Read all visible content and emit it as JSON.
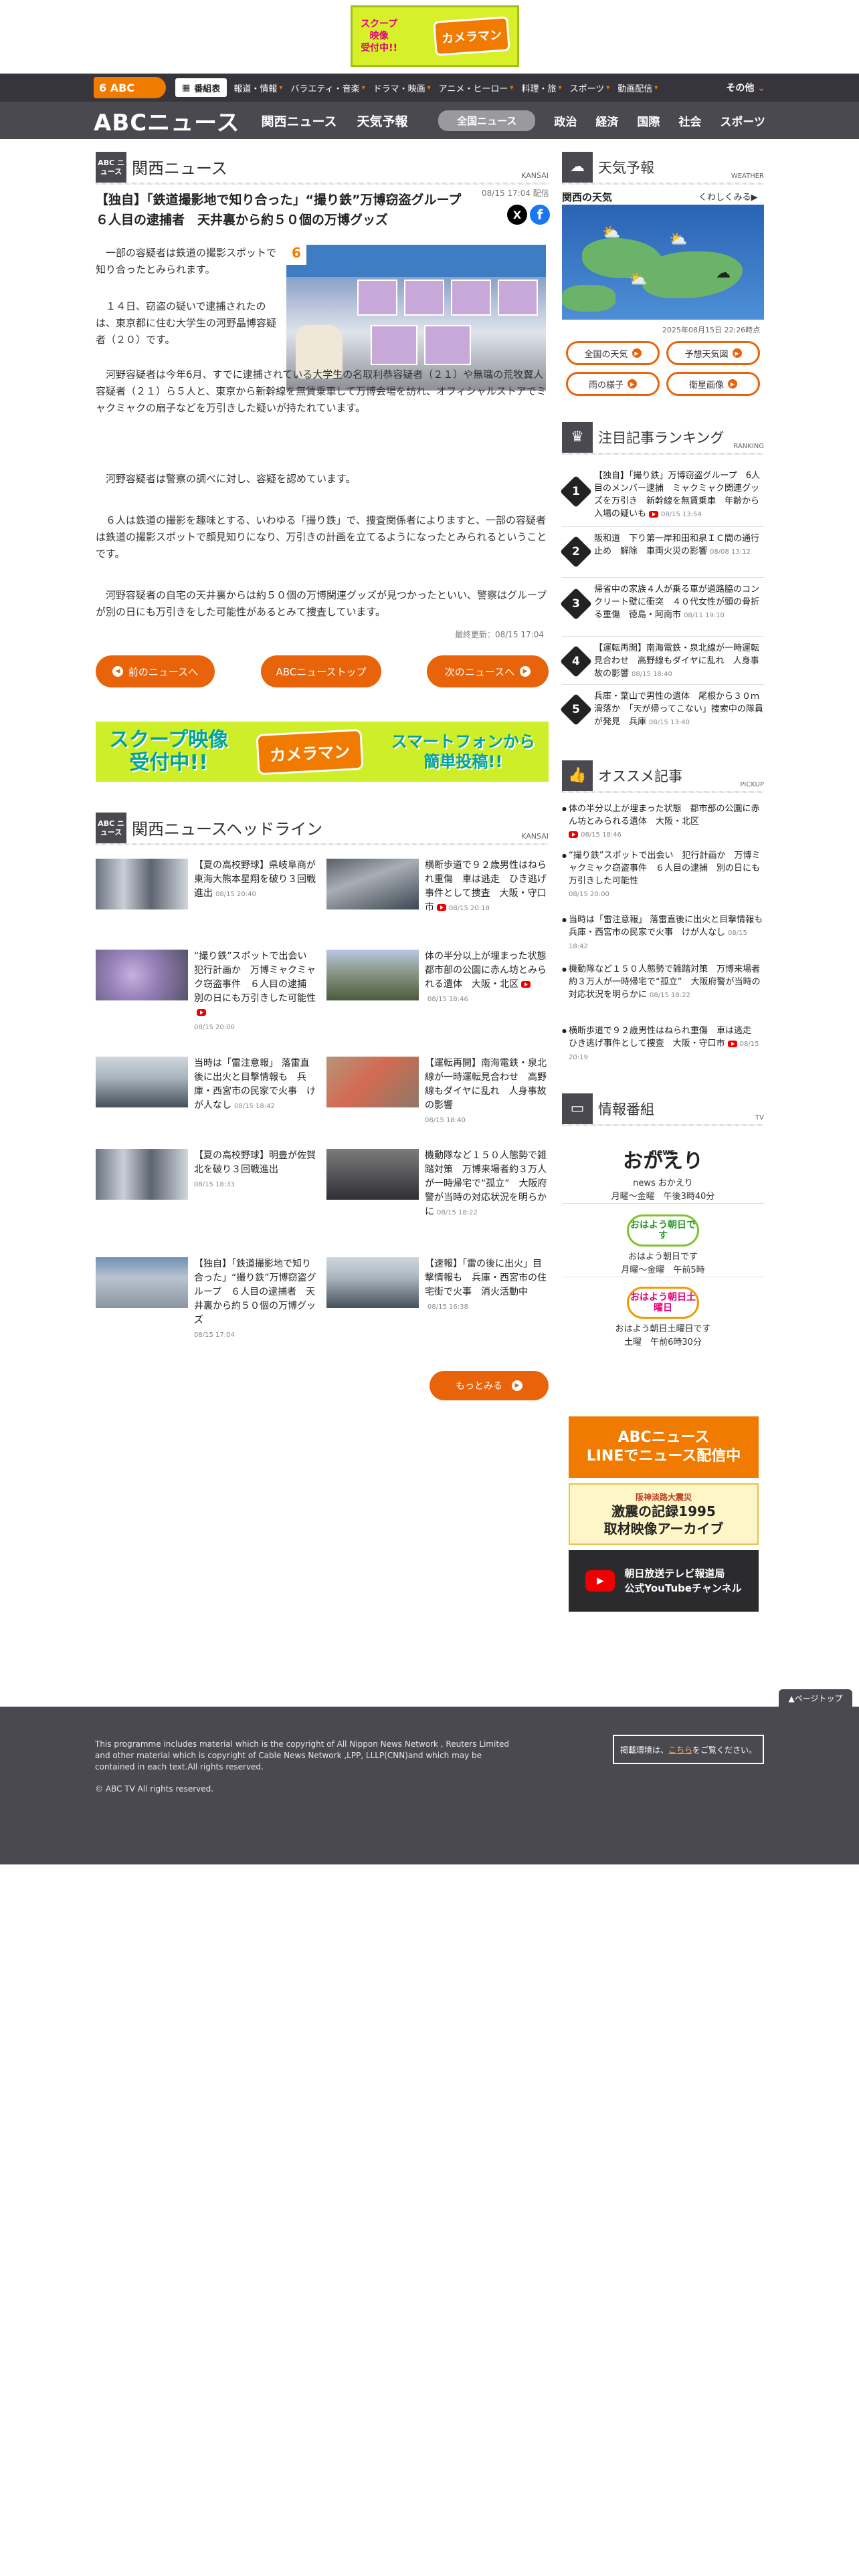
{
  "top_banner": {
    "line1": "スクープ",
    "line2": "映像",
    "line3": "受付中!!",
    "brand": "カメラマン"
  },
  "nav1": {
    "logo": "6 ABC",
    "bangumi": "番組表",
    "items": [
      "報道・情報",
      "バラエティ・音楽",
      "ドラマ・映画",
      "アニメ・ヒーロー",
      "料理・旅",
      "スポーツ",
      "動画配信"
    ],
    "other": "その他"
  },
  "nav2": {
    "logo": "ABCニュース",
    "items": [
      "関西ニュース",
      "天気予報"
    ],
    "pill": "全国ニュース",
    "right": [
      "政治",
      "経済",
      "国際",
      "社会",
      "スポーツ"
    ]
  },
  "section": {
    "icon": "ABC ニュース",
    "title": "関西ニュース",
    "tag": "KANSAI"
  },
  "article": {
    "title": "【独自】「鉄道撮影地で知り合った」“撮り鉄”万博窃盗グループ　６人目の逮捕者　天井裏から約５０個の万博グッズ",
    "meta": "08/15 17:04 配信",
    "share_x": "X",
    "share_fb": "f",
    "photo_label": "6",
    "p1": "一部の容疑者は鉄道の撮影スポットで知り合ったとみられます。",
    "p2": "１４日、窃盗の疑いで逮捕されたのは、東京都に住む大学生の河野晶博容疑者（２０）です。",
    "p3": "河野容疑者は今年6月、すでに逮捕されている大学生の名取利恭容疑者（２１）や無職の荒牧翼人容疑者（２１）ら５人と、東京から新幹線を無賃乗車して万博会場を訪れ、オフィシャルストアでミャクミャクの扇子などを万引きした疑いが持たれています。",
    "p4": "河野容疑者は警察の調べに対し、容疑を認めています。",
    "p5": "６人は鉄道の撮影を趣味とする、いわゆる「撮り鉄」で、捜査関係者によりますと、一部の容疑者は鉄道の撮影スポットで顔見知りになり、万引きの計画を立てるようになったとみられるということです。",
    "p6": "河野容疑者の自宅の天井裏からは約５０個の万博関連グッズが見つかったといい、警察はグループが別の日にも万引きをした可能性があるとみて捜査しています。",
    "updated": "最終更新：08/15 17:04"
  },
  "nav_buttons": {
    "prev": "前のニュースへ",
    "top": "ABCニューストップ",
    "next": "次のニュースへ"
  },
  "mid_banner": {
    "left": "スクープ映像\n受付中!!",
    "brand": "カメラマン",
    "right": "スマートフォンから\n簡単投稿!!"
  },
  "headline_section": {
    "icon": "ABC ニュース",
    "title": "関西ニュースヘッドライン",
    "tag": "KANSAI"
  },
  "headlines": [
    {
      "text": "【夏の高校野球】県岐阜商が東海大熊本星翔を破り３回戦進出",
      "date": "08/15 20:40",
      "yt": false
    },
    {
      "text": "横断歩道で９２歳男性はねられ重傷　車は逃走　ひき逃げ事件として捜査　大阪・守口市",
      "date": "08/15 20:18",
      "yt": true
    },
    {
      "text": "“撮り鉄”スポットで出会い　犯行計画か　万博ミャクミャク窃盗事件　６人目の逮捕　別の日にも万引きした可能性",
      "date": "08/15 20:00",
      "yt": true
    },
    {
      "text": "体の半分以上が埋まった状態　都市部の公園に赤ん坊とみられる遺体　大阪・北区",
      "date": "08/15 18:46",
      "yt": true
    },
    {
      "text": "当時は「雷注意報」 落雷直後に出火と目撃情報も　兵庫・西宮市の民家で火事　けが人なし",
      "date": "08/15 18:42",
      "yt": false
    },
    {
      "text": "【運転再開】南海電鉄・泉北線が一時運転見合わせ　高野線もダイヤに乱れ　人身事故の影響",
      "date": "08/15 18:40",
      "yt": false
    },
    {
      "text": "【夏の高校野球】明豊が佐賀北を破り３回戦進出",
      "date": "08/15 18:33",
      "yt": false
    },
    {
      "text": "機動隊など１５０人態勢で雑踏対策　万博来場者約３万人が一時帰宅で“孤立”　大阪府警が当時の対応状況を明らかに",
      "date": "08/15 18:22",
      "yt": false
    },
    {
      "text": "【独自】「鉄道撮影地で知り合った」“撮り鉄”万博窃盗グループ　６人目の逮捕者　天井裏から約５０個の万博グッズ",
      "date": "08/15 17:04",
      "yt": false
    },
    {
      "text": "【速報】「雷の後に出火」目撃情報も　兵庫・西宮市の住宅街で火事　消火活動中",
      "date": "08/15 16:38",
      "yt": false
    }
  ],
  "more_button": "もっとみる",
  "weather": {
    "title": "天気予報",
    "tag": "WEATHER",
    "area": "関西の天気",
    "more": "くわしくみる",
    "date": "2025年08月15日 22:26時点",
    "buttons": [
      "全国の天気",
      "予想天気図",
      "雨の様子",
      "衛星画像"
    ]
  },
  "ranking": {
    "title": "注目記事ランキング",
    "tag": "RANKING",
    "items": [
      {
        "rank": "1",
        "text": "【独自】「撮り鉄」万博窃盗グループ　6人目のメンバー逮捕　ミャクミャク関連グッズを万引き　新幹線を無賃乗車　年齢から入場の疑いも",
        "date": "08/15 13:54",
        "yt": true
      },
      {
        "rank": "2",
        "text": "阪和道　下り第一岸和田和泉ＩＣ間の通行止め　解除　車両火災の影響",
        "date": "08/08 13:12",
        "yt": false
      },
      {
        "rank": "3",
        "text": "帰省中の家族４人が乗る車が道路脇のコンクリート壁に衝突　４０代女性が頭の骨折る重傷　徳島・阿南市",
        "date": "08/11 19:10",
        "yt": false
      },
      {
        "rank": "4",
        "text": "【運転再開】南海電鉄・泉北線が一時運転見合わせ　高野線もダイヤに乱れ　人身事故の影響",
        "date": "08/15 18:40",
        "yt": false
      },
      {
        "rank": "5",
        "text": "兵庫・葉山で男性の遺体　尾根から３０ｍ滑落か　「天が帰ってこない」捜索中の隊員が発見　兵庫",
        "date": "08/15 13:40",
        "yt": false
      }
    ]
  },
  "pickup": {
    "title": "オススメ記事",
    "tag": "PICKUP",
    "items": [
      {
        "text": "体の半分以上が埋まった状態　都市部の公園に赤ん坊とみられる遺体　大阪・北区",
        "date": "08/15 18:46",
        "yt": true
      },
      {
        "text": "“撮り鉄”スポットで出会い　犯行計画か　万博ミャクミャク窃盗事件　６人目の逮捕　別の日にも万引きした可能性",
        "date": "08/15 20:00",
        "yt": true
      },
      {
        "text": "当時は「雷注意報」 落雷直後に出火と目撃情報も　兵庫・西宮市の民家で火事　けが人なし",
        "date": "08/15 18:42",
        "yt": false
      },
      {
        "text": "機動隊など１５０人態勢で雑踏対策　万博来場者約３万人が一時帰宅で“孤立”　大阪府警が当時の対応状況を明らかに",
        "date": "08/15 18:22",
        "yt": false
      },
      {
        "text": "横断歩道で９２歳男性はねられ重傷　車は逃走　ひき逃げ事件として捜査　大阪・守口市",
        "date": "08/15 20:19",
        "yt": true
      }
    ]
  },
  "programs": {
    "title": "情報番組",
    "tag": "TV",
    "items": [
      {
        "logo": "おかえり",
        "logo_sub": "news",
        "name": "news おかえり",
        "time": "月曜〜金曜　午後3時40分"
      },
      {
        "logo": "おはよう朝日です",
        "logo_sub": "",
        "name": "おはよう朝日です",
        "time": "月曜〜金曜　午前5時"
      },
      {
        "logo": "おはよう朝日土曜日",
        "logo_sub": "",
        "name": "おはよう朝日土曜日です",
        "time": "土曜　午前6時30分"
      }
    ]
  },
  "side_banners": {
    "line": "ABCニュース\nLINEでニュース配信中",
    "archive_sub": "阪神淡路大震災",
    "archive": "激震の記録1995\n取材映像アーカイブ",
    "youtube": "朝日放送テレビ報道局\n公式YouTubeチャンネル"
  },
  "pagetop": "▲ページトップ",
  "footer": {
    "copy": "This programme includes material which is the copyright of All Nippon News Network , Reuters Limited and other material which is copyright of Cable News Network ,LPP, LLLP(CNN)and which may be contained in each text.All rights reserved.",
    "c": "© ABC TV All rights reserved.",
    "box_pre": "掲載環境は、",
    "box_link": "こちら",
    "box_post": "をご覧ください。"
  }
}
